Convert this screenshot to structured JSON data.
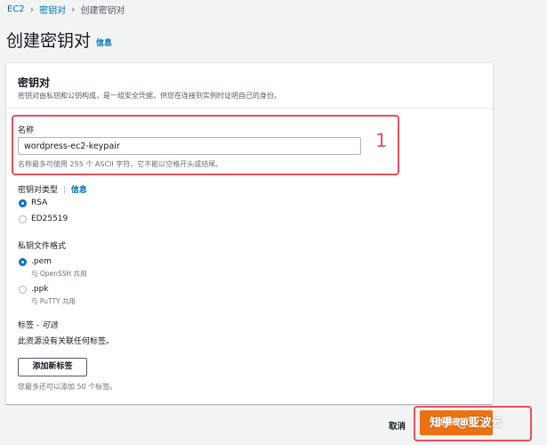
{
  "breadcrumb": {
    "items": [
      "EC2",
      "密钥对",
      "创建密钥对"
    ]
  },
  "page": {
    "title": "创建密钥对",
    "info": "信息"
  },
  "panel": {
    "title": "密钥对",
    "description": "密钥对由私钥和公钥构成，是一组安全凭据，供您在连接到实例时证明自己的身份。"
  },
  "name_field": {
    "label": "名称",
    "value": "wordpress-ec2-keypair",
    "hint": "名称最多可使用 255 个 ASCII 字符。它不能以空格开头或结尾。"
  },
  "key_type": {
    "label": "密钥对类型",
    "info": "信息",
    "options": [
      {
        "label": "RSA",
        "selected": true
      },
      {
        "label": "ED25519",
        "selected": false
      }
    ]
  },
  "file_format": {
    "label": "私钥文件格式",
    "options": [
      {
        "label": ".pem",
        "hint": "与 OpenSSH 共用",
        "selected": true
      },
      {
        "label": ".ppk",
        "hint": "与 PuTTY 共用",
        "selected": false
      }
    ]
  },
  "tags": {
    "label": "标签 - ",
    "label_optional": "可选",
    "empty_text": "此资源没有关联任何标签。",
    "add_button": "添加新标签",
    "limit_hint": "您最多还可以添加 50 个标签。"
  },
  "footer": {
    "cancel": "取消",
    "create": "创建密钥对"
  },
  "annotation": {
    "number": "1"
  },
  "watermark": {
    "text": "知乎 @亚波云"
  },
  "colors": {
    "link": "#0073bb",
    "primary_button": "#ec7211",
    "annotation": "#e8505b",
    "radio_selected": "#0073bb"
  }
}
